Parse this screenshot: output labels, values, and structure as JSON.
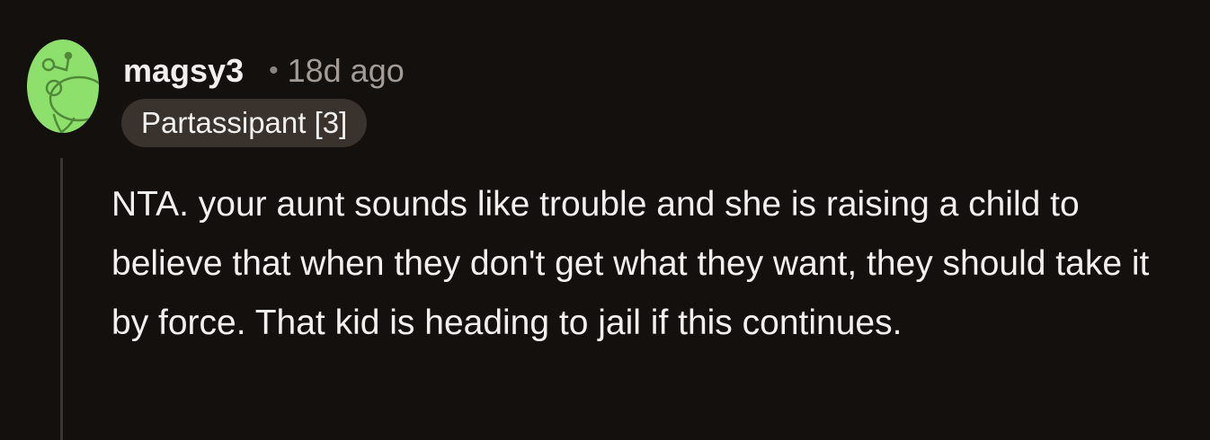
{
  "comment": {
    "username": "magsy3",
    "separator": "•",
    "timestamp": "18d ago",
    "flair": "Partassipant [3]",
    "body": "NTA. your aunt sounds like trouble and she is raising a child to believe that when they don't get what they want, they should take it by force. That kid is heading to jail if this continues.",
    "avatar_icon": "snoo-avatar-icon"
  },
  "colors": {
    "background": "#14100d",
    "text": "#f2f0ee",
    "muted": "#a39b96",
    "flair_bg": "#3a322c",
    "avatar_green": "#8ee06c"
  }
}
